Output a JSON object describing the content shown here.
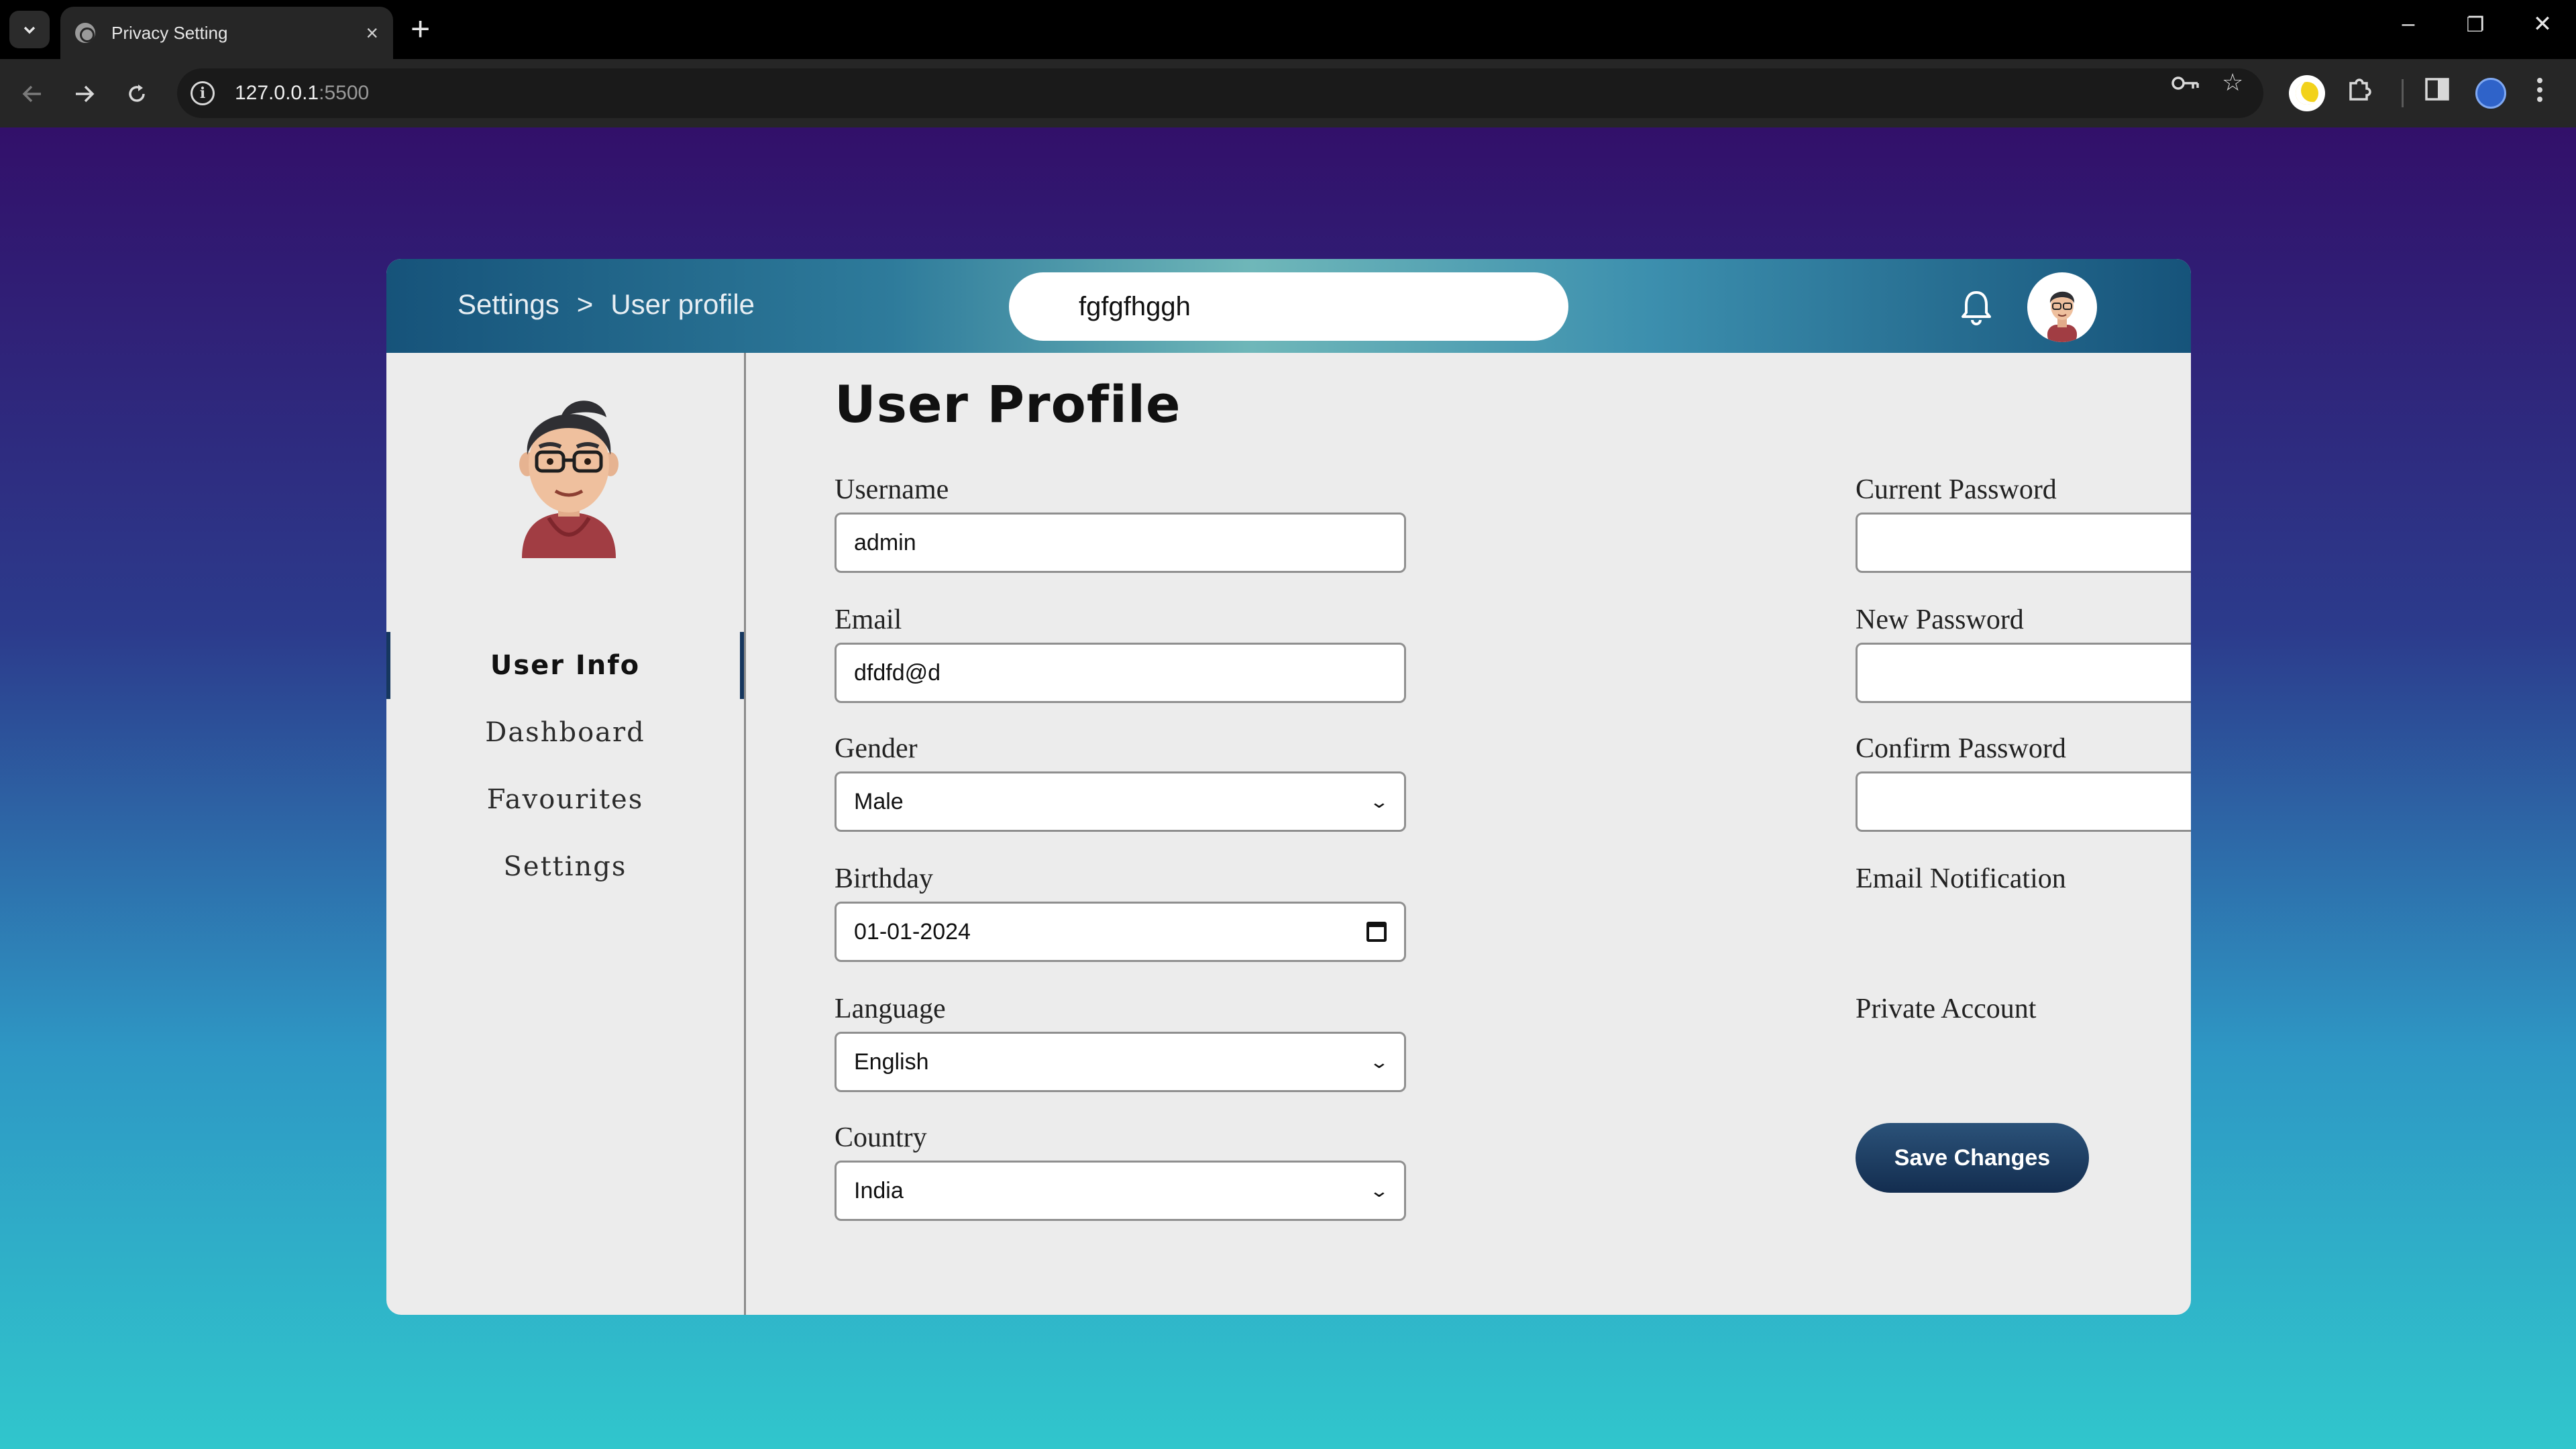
{
  "browser": {
    "tab_title": "Privacy Setting",
    "tab_close": "×",
    "new_tab": "+",
    "url_host": "127.0.0.1",
    "url_port": ":5500",
    "window_controls": {
      "minimize": "–",
      "restore": "❐",
      "close": "✕"
    }
  },
  "header": {
    "breadcrumb": {
      "root": "Settings",
      "separator": ">",
      "current": "User profile"
    },
    "search_value": "fgfgfhggh"
  },
  "sidebar": {
    "items": [
      {
        "label": "User Info",
        "active": true
      },
      {
        "label": "Dashboard",
        "active": false
      },
      {
        "label": "Favourites",
        "active": false
      },
      {
        "label": "Settings",
        "active": false
      }
    ]
  },
  "main": {
    "title": "User Profile",
    "fields": {
      "username": {
        "label": "Username",
        "value": "admin"
      },
      "email": {
        "label": "Email",
        "value": "dfdfd@d"
      },
      "gender": {
        "label": "Gender",
        "value": "Male"
      },
      "birthday": {
        "label": "Birthday",
        "value": "01-01-2024"
      },
      "language": {
        "label": "Language",
        "value": "English"
      },
      "country": {
        "label": "Country",
        "value": "India"
      },
      "current_password": {
        "label": "Current Password",
        "value": ""
      },
      "new_password": {
        "label": "New Password",
        "value": ""
      },
      "confirm_password": {
        "label": "Confirm Password",
        "value": ""
      }
    },
    "toggles": {
      "email_notification": {
        "label": "Email Notification",
        "on": false
      },
      "private_account": {
        "label": "Private Account",
        "on": true
      }
    },
    "save_label": "Save Changes"
  },
  "colors": {
    "accent": "#4b79e3",
    "button": "#132d4f",
    "page_gradient": [
      "#32106a",
      "#30c6cc"
    ]
  },
  "icons": [
    "tab-search-icon",
    "globe-favicon-icon",
    "back-icon",
    "forward-icon",
    "reload-icon",
    "info-icon",
    "key-icon",
    "star-icon",
    "moon-extension-icon",
    "puzzle-icon",
    "side-panel-icon",
    "profile-globe-icon",
    "kebab-menu-icon",
    "bell-icon",
    "avatar",
    "chevron-down-icon",
    "calendar-icon"
  ]
}
